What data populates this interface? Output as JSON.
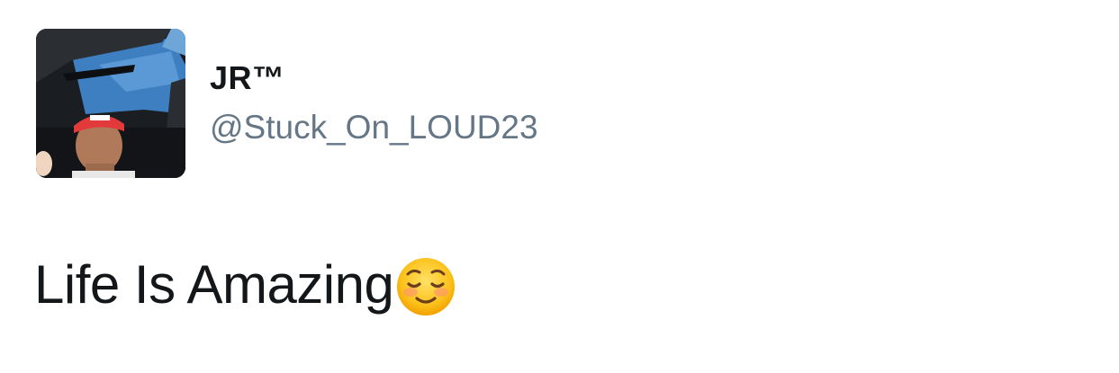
{
  "tweet": {
    "display_name": "JR™",
    "handle": "@Stuck_On_LOUD23",
    "text": "Life Is Amazing",
    "emoji_icon": "smiling-face-emoji"
  },
  "colors": {
    "name": "#14171a",
    "handle": "#657786",
    "text": "#14171a",
    "emoji_face": "#fcc21b"
  }
}
